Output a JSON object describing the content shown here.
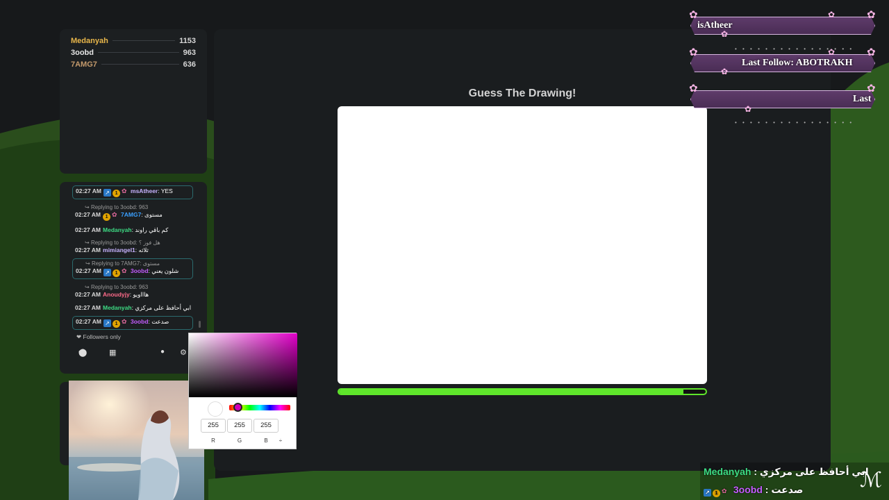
{
  "leaderboard": [
    {
      "name": "Medanyah",
      "score": "1153",
      "color": "#e8b64a"
    },
    {
      "name": "3oobd",
      "score": "963",
      "color": "#e6e6e6"
    },
    {
      "name": "7AMG7",
      "score": "636",
      "color": "#c49a6c"
    }
  ],
  "chat": {
    "messages": [
      {
        "time": "02:27 AM",
        "user": "msAtheer",
        "user_color": "#c7b3ff",
        "text": "YES",
        "reply": "",
        "highlight": true
      },
      {
        "time": "02:27 AM",
        "user": "7AMG7",
        "user_color": "#3aa0ff",
        "text": "مستوى",
        "reply": "Replying to 3oobd: 963",
        "highlight": false
      },
      {
        "time": "02:27 AM",
        "user": "Medanyah",
        "user_color": "#3ddc84",
        "text": "كم باقي راوند",
        "reply": "",
        "highlight": false
      },
      {
        "time": "02:27 AM",
        "user": "mimiangel1",
        "user_color": "#c7b3ff",
        "text": "ثلاثه",
        "reply": "Replying to 3oobd: هل فوز ؟",
        "highlight": false
      },
      {
        "time": "02:27 AM",
        "user": "3oobd",
        "user_color": "#c45cff",
        "text": "شلون يعني",
        "reply": "Replying to 7AMG7: مستوى",
        "highlight": true
      },
      {
        "time": "02:27 AM",
        "user": "Anoudyjy",
        "user_color": "#ff6b8a",
        "text": "هاااويو",
        "reply": "Replying to 3oobd: 963",
        "highlight": false
      },
      {
        "time": "02:27 AM",
        "user": "Medanyah",
        "user_color": "#3ddc84",
        "text": "ابي أحافظ على مركزي",
        "reply": "",
        "highlight": false
      },
      {
        "time": "02:27 AM",
        "user": "3oobd",
        "user_color": "#c45cff",
        "text": "صدعت",
        "reply": "",
        "highlight": true
      }
    ],
    "followers_label": "Followers only",
    "points_label": "∞"
  },
  "game": {
    "title": "Guess The Drawing!",
    "progress": 0.94
  },
  "picker": {
    "r": "255",
    "g": "255",
    "b": "255",
    "labels": [
      "R",
      "G",
      "B"
    ],
    "arrows": "÷"
  },
  "alerts": [
    {
      "text": "isAtheer"
    },
    {
      "text": "Last Follow: ABOTRAKH"
    },
    {
      "text": "Last"
    }
  ],
  "overlay_chat": [
    {
      "user": "Medanyah",
      "user_color": "#3ddc84",
      "sep": " : ",
      "text": "ابي أحافظ على مركزي"
    },
    {
      "user": "3oobd",
      "user_color": "#c45cff",
      "sep": " : ",
      "text": "صدعت"
    }
  ],
  "colors": {
    "accent": "#5fe62b",
    "alert_bg": "#5e3b6a",
    "panel": "#1c1f21"
  }
}
